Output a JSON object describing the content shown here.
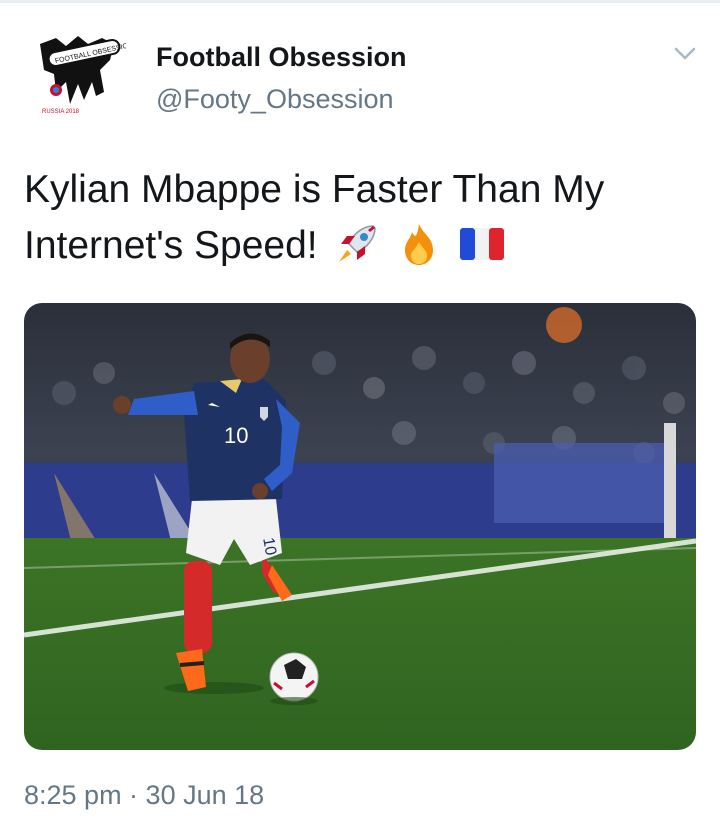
{
  "account": {
    "name": "Football Obsession",
    "handle": "@Footy_Obsession",
    "avatar_text": "FOOTBALL OBSESSION",
    "avatar_badge": "RUSSIA 2018"
  },
  "tweet": {
    "text": "Kylian Mbappe is Faster Than My Internet's Speed!",
    "emojis": [
      "rocket-emoji",
      "fire-emoji",
      "france-flag-emoji"
    ]
  },
  "photo": {
    "jersey_number": "10",
    "short_number": "10"
  },
  "timestamp": "8:25 pm · 30 Jun 18",
  "colors": {
    "handle_gray": "#657786",
    "text": "#14171a",
    "pitch": "#3f7a2a",
    "kit_blue": "#1e3264",
    "socks_red": "#d42a2a"
  }
}
